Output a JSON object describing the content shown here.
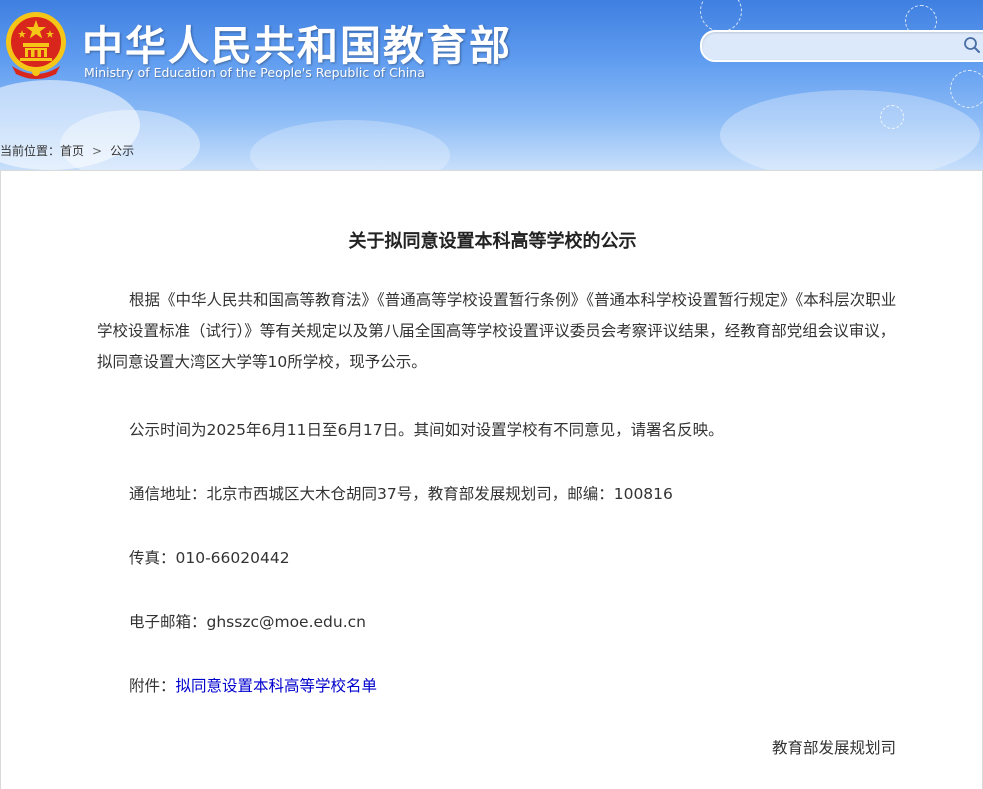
{
  "header": {
    "cn_title": "中华人民共和国教育部",
    "en_title": "Ministry of Education of the People's Republic of China",
    "emblem_icon": "national-emblem-icon",
    "search_icon": "search-icon",
    "search_placeholder": ""
  },
  "breadcrumb": {
    "prefix": "当前位置：",
    "home": "首页",
    "separator": ">",
    "current": "公示"
  },
  "article": {
    "title": "关于拟同意设置本科高等学校的公示",
    "para1": "根据《中华人民共和国高等教育法》《普通高等学校设置暂行条例》《普通本科学校设置暂行规定》《本科层次职业学校设置标准（试行）》等有关规定以及第八届全国高等学校设置评议委员会考察评议结果，经教育部党组会议审议，拟同意设置大湾区大学等10所学校，现予公示。",
    "para2": "公示时间为2025年6月11日至6月17日。其间如对设置学校有不同意见，请署名反映。",
    "para3": "通信地址：北京市西城区大木仓胡同37号，教育部发展规划司，邮编：100816",
    "para4": "传真：010-66020442",
    "para5": "电子邮箱：ghsszc@moe.edu.cn",
    "attachment_label": "附件：",
    "attachment_link": "拟同意设置本科高等学校名单",
    "signature": "教育部发展规划司"
  },
  "colors": {
    "header_top": "#3f7fe0",
    "header_bottom": "#c7dffb",
    "link": "#0000cc",
    "emblem_red": "#d8261c",
    "emblem_gold": "#f5c518"
  }
}
